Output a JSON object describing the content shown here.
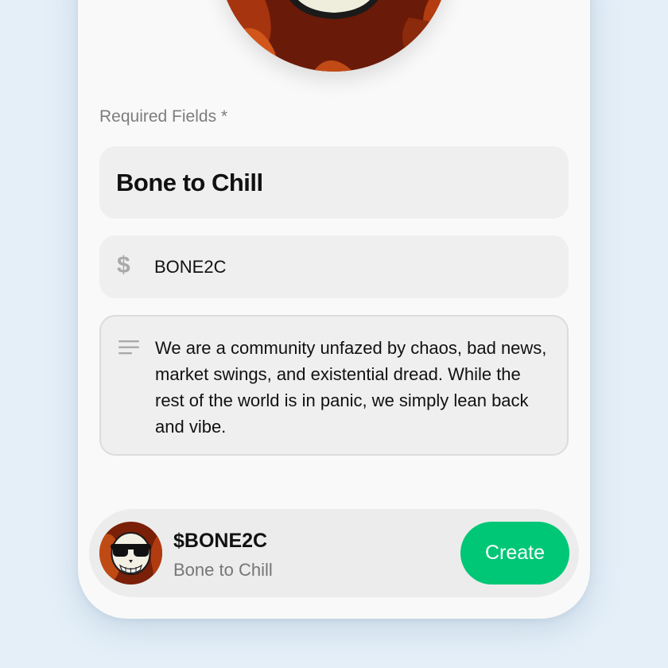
{
  "form": {
    "section_label": "Required Fields *",
    "name_value": "Bone to Chill",
    "ticker_icon": "dollar-icon",
    "ticker_value": "BONE2C",
    "description_icon": "lines-icon",
    "description_value": "We are a community unfazed by chaos, bad news, market swings, and existential dread. While the rest of the world is in panic, we simply lean back and vibe."
  },
  "summary": {
    "ticker": "$BONE2C",
    "name": "Bone to Chill",
    "create_label": "Create"
  },
  "colors": {
    "accent": "#00c776",
    "background": "#e4eff8",
    "card": "#f9f9f9",
    "field": "#efefef"
  }
}
